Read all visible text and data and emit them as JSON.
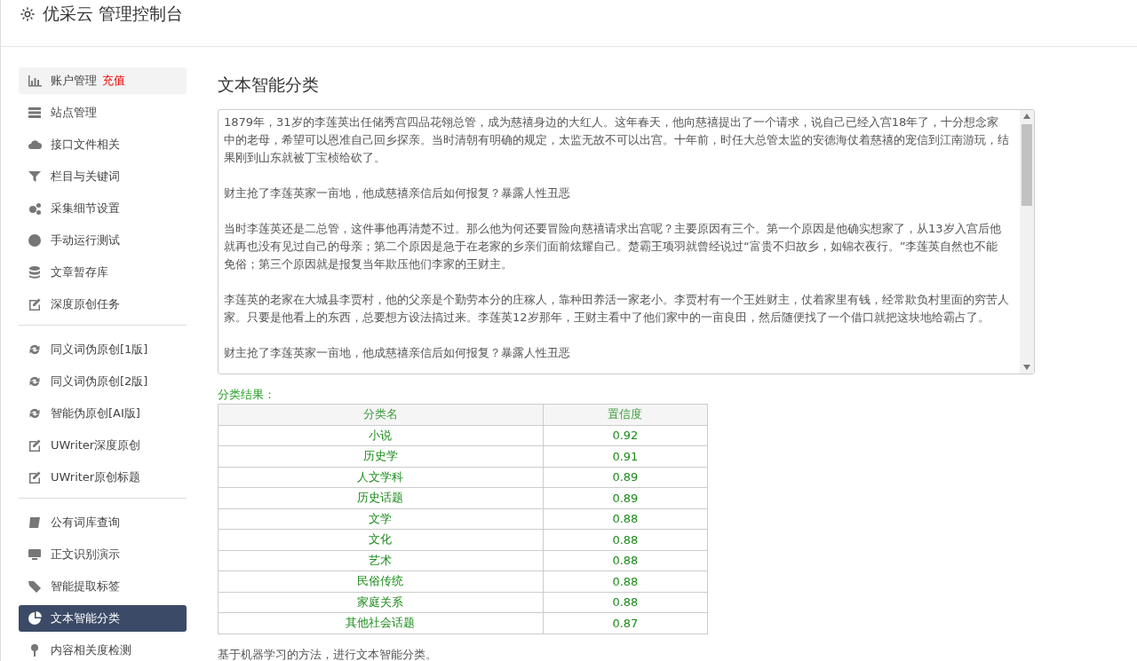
{
  "header": {
    "title": "优采云 管理控制台"
  },
  "sidebar": {
    "groups": [
      [
        {
          "label": "账户管理",
          "badge": "充值",
          "hovered": true,
          "selected": false
        },
        {
          "label": "站点管理",
          "hovered": false,
          "selected": false
        },
        {
          "label": "接口文件相关",
          "hovered": false,
          "selected": false
        },
        {
          "label": "栏目与关键词",
          "hovered": false,
          "selected": false
        },
        {
          "label": "采集细节设置",
          "hovered": false,
          "selected": false
        },
        {
          "label": "手动运行测试",
          "hovered": false,
          "selected": false
        },
        {
          "label": "文章暂存库",
          "hovered": false,
          "selected": false
        },
        {
          "label": "深度原创任务",
          "hovered": false,
          "selected": false
        }
      ],
      [
        {
          "label": "同义词伪原创[1版]",
          "hovered": false,
          "selected": false
        },
        {
          "label": "同义词伪原创[2版]",
          "hovered": false,
          "selected": false
        },
        {
          "label": "智能伪原创[AI版]",
          "hovered": false,
          "selected": false
        },
        {
          "label": "UWriter深度原创",
          "hovered": false,
          "selected": false
        },
        {
          "label": "UWriter原创标题",
          "hovered": false,
          "selected": false
        }
      ],
      [
        {
          "label": "公有词库查询",
          "hovered": false,
          "selected": false
        },
        {
          "label": "正文识别演示",
          "hovered": false,
          "selected": false
        },
        {
          "label": "智能提取标签",
          "hovered": false,
          "selected": false
        },
        {
          "label": "文本智能分类",
          "hovered": false,
          "selected": true
        },
        {
          "label": "内容相关度检测",
          "hovered": false,
          "selected": false
        }
      ]
    ]
  },
  "main": {
    "title": "文本智能分类",
    "input_paragraphs": [
      "1879年，31岁的李莲英出任储秀宫四品花翎总管，成为慈禧身边的大红人。这年春天，他向慈禧提出了一个请求，说自己已经入宫18年了，十分想念家中的老母，希望可以恩准自己回乡探亲。当时清朝有明确的规定，太监无故不可以出宫。十年前，时任大总管太监的安德海仗着慈禧的宠信到江南游玩，结果刚到山东就被丁宝桢给砍了。",
      "财主抢了李莲英家一亩地，他成慈禧亲信后如何报复？暴露人性丑恶",
      "当时李莲英还是二总管，这件事他再清楚不过。那么他为何还要冒险向慈禧请求出宫呢？主要原因有三个。第一个原因是他确实想家了，从13岁入宫后他就再也没有见过自己的母亲；第二个原因是急于在老家的乡亲们面前炫耀自己。楚霸王项羽就曾经说过“富贵不归故乡，如锦衣夜行。”李莲英自然也不能免俗；第三个原因就是报复当年欺压他们李家的王财主。",
      "李莲英的老家在大城县李贾村，他的父亲是个勤劳本分的庄稼人，靠种田养活一家老小。李贾村有一个王姓财主，仗着家里有钱，经常欺负村里面的穷苦人家。只要是他看上的东西，总要想方设法搞过来。李莲英12岁那年，王财主看中了他们家中的一亩良田，然后随便找了一个借口就把这块地给霸占了。",
      "财主抢了李莲英家一亩地，他成慈禧亲信后如何报复？暴露人性丑恶"
    ],
    "result_label": "分类结果：",
    "table": {
      "columns": [
        "分类名",
        "置信度"
      ],
      "rows": [
        [
          "小说",
          "0.92"
        ],
        [
          "历史学",
          "0.91"
        ],
        [
          "人文学科",
          "0.89"
        ],
        [
          "历史话题",
          "0.89"
        ],
        [
          "文学",
          "0.88"
        ],
        [
          "文化",
          "0.88"
        ],
        [
          "艺术",
          "0.88"
        ],
        [
          "民俗传统",
          "0.88"
        ],
        [
          "家庭关系",
          "0.88"
        ],
        [
          "其他社会话题",
          "0.87"
        ]
      ]
    },
    "note": "基于机器学习的方法，进行文本智能分类。"
  }
}
